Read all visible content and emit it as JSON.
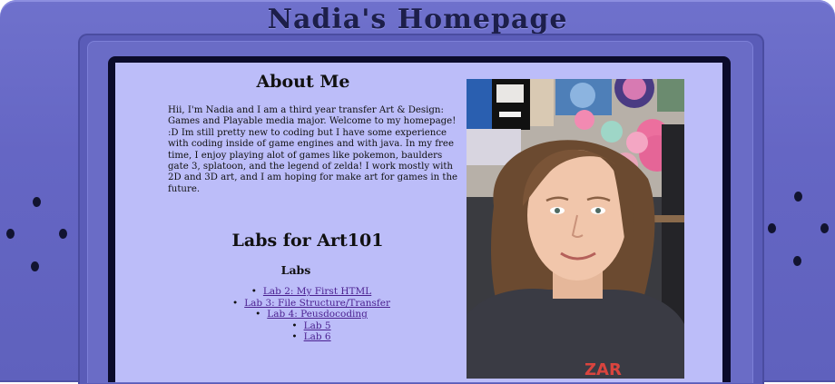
{
  "page": {
    "title": "Nadia's Homepage"
  },
  "about": {
    "heading": "About Me",
    "body": "Hii, I'm Nadia and I am a third year transfer Art & Design: Games and Playable media major. Welcome to my homepage! :D Im still pretty new to coding but I have some experience with coding inside of game engines and with java. In my free time, I enjoy playing alot of games like pokemon, baulders gate 3, splatoon, and the legend of zelda! I work mostly with 2D and 3D art, and I am hoping for make art for games in the future."
  },
  "labs": {
    "heading": "Labs for Art101",
    "subheading": "Labs",
    "items": [
      {
        "label": "Lab 2: My First HTML"
      },
      {
        "label": "Lab 3: File Structure/Transfer"
      },
      {
        "label": "Lab 4: Peusdocoding"
      },
      {
        "label": "Lab 5"
      },
      {
        "label": "Lab 6"
      }
    ]
  },
  "photo": {
    "subject": "portrait of Nadia in front of plush toys and posters",
    "shirt_text": "ZAR"
  },
  "colors": {
    "console_body": "#6566c4",
    "screen_background": "#bcbdf9",
    "screen_frame": "#0b0b2a",
    "link": "#4a1f8f",
    "title_text": "#1d1f4a"
  }
}
